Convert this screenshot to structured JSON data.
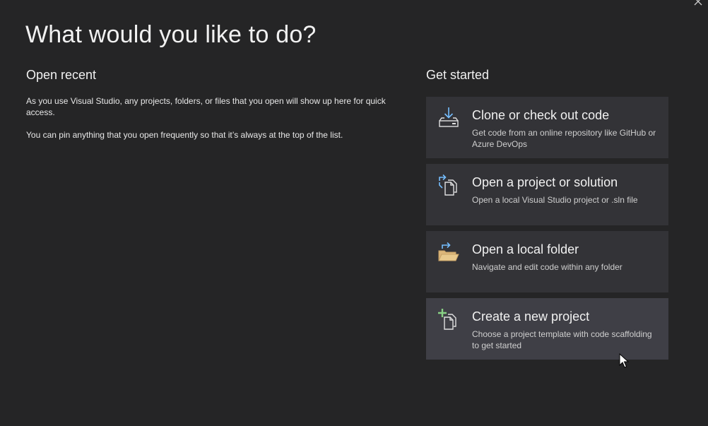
{
  "page": {
    "title": "What would you like to do?"
  },
  "open_recent": {
    "heading": "Open recent",
    "paragraphs": [
      "As you use Visual Studio, any projects, folders, or files that you open will show up here for quick access.",
      "You can pin anything that you open frequently so that it’s always at the top of the list."
    ]
  },
  "get_started": {
    "heading": "Get started",
    "cards": [
      {
        "title": "Clone or check out code",
        "description": "Get code from an online repository like GitHub or Azure DevOps",
        "icon": "clone-download-icon"
      },
      {
        "title": "Open a project or solution",
        "description": "Open a local Visual Studio project or .sln file",
        "icon": "open-project-icon"
      },
      {
        "title": "Open a local folder",
        "description": "Navigate and edit code within any folder",
        "icon": "open-folder-icon"
      },
      {
        "title": "Create a new project",
        "description": "Choose a project template with code scaffolding to get started",
        "icon": "new-project-icon",
        "hovered": true
      }
    ]
  },
  "colors": {
    "background": "#252526",
    "card": "#333337",
    "card_hover": "#3f3f46",
    "accent_blue": "#75beff",
    "folder_orange": "#dcb67a",
    "plus_green": "#89d185"
  }
}
